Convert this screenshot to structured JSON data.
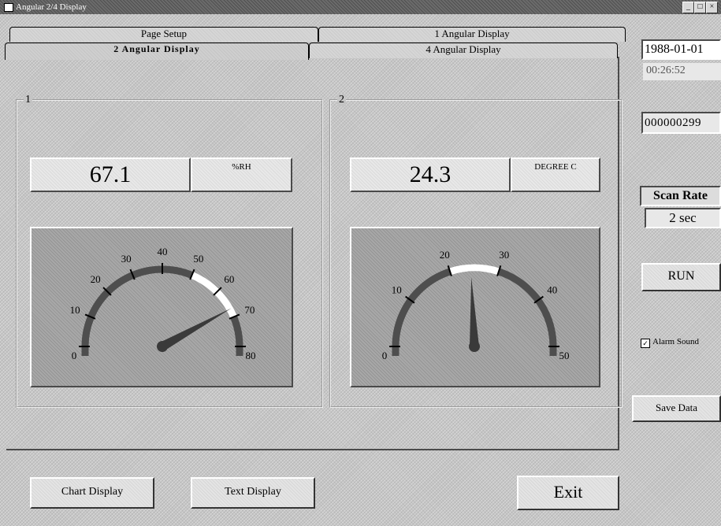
{
  "window": {
    "title": "Angular 2/4 Display"
  },
  "tabs": {
    "page_setup": "Page Setup",
    "one_angular": "1 Angular Display",
    "two_angular": "2 Angular Display",
    "four_angular": "4 Angular Display"
  },
  "channels": [
    {
      "label": "1",
      "value": "67.1",
      "unit": "%RH",
      "gauge": {
        "min": 0,
        "max": 80,
        "value": 67.1,
        "ticks": [
          "0",
          "10",
          "20",
          "30",
          "40",
          "50",
          "60",
          "70",
          "80"
        ],
        "highlight_range": [
          50,
          70
        ]
      }
    },
    {
      "label": "2",
      "value": "24.3",
      "unit": "DEGREE C",
      "gauge": {
        "min": 0,
        "max": 50,
        "value": 24.3,
        "ticks": [
          "0",
          "10",
          "20",
          "30",
          "40",
          "50"
        ],
        "highlight_range": [
          20,
          30
        ]
      }
    }
  ],
  "side": {
    "date": "1988-01-01",
    "time": "00:26:52",
    "counter": "000000299",
    "scan_rate_label": "Scan Rate",
    "scan_rate_value": "2 sec",
    "run_label": "RUN",
    "alarm_label": "Alarm Sound",
    "alarm_checked": true,
    "save_label": "Save Data"
  },
  "bottom": {
    "chart_display": "Chart Display",
    "text_display": "Text Display",
    "exit": "Exit"
  },
  "colors": {
    "gauge_arc": "#4e4e4e",
    "gauge_highlight": "#ffffff",
    "needle": "#3a3a3a"
  }
}
